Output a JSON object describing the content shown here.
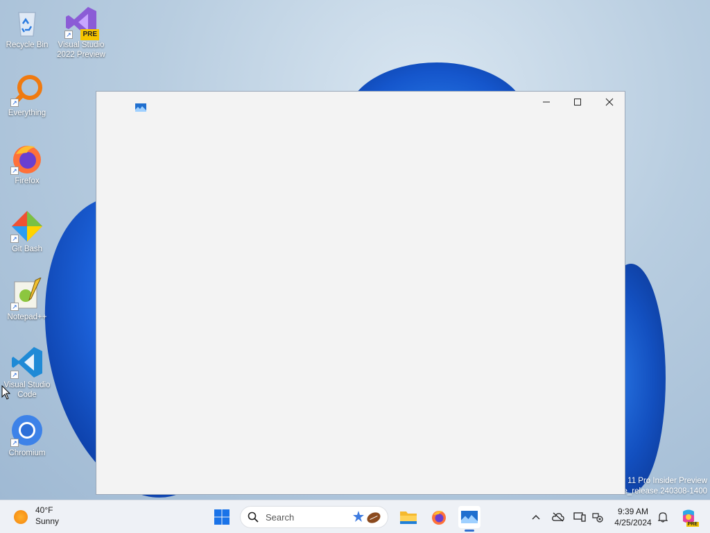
{
  "desktop": {
    "icons": [
      {
        "label": "Recycle Bin"
      },
      {
        "label": "Visual Studio 2022 Preview",
        "badge": "PRE"
      },
      {
        "label": "Everything"
      },
      {
        "label": "Firefox"
      },
      {
        "label": "Git Bash"
      },
      {
        "label": "Notepad++"
      },
      {
        "label": "Visual Studio Code"
      },
      {
        "label": "Chromium"
      }
    ],
    "watermark": {
      "line1": "11 Pro Insider Preview",
      "line2": "e_release.240308-1400"
    }
  },
  "window": {
    "icon": "app-image-icon",
    "controls": [
      "minimize-icon",
      "maximize-icon",
      "close-icon"
    ]
  },
  "taskbar": {
    "weather": {
      "temperature": "40°F",
      "condition": "Sunny"
    },
    "search_placeholder": "Search",
    "pinned": [
      "start-icon",
      "file-explorer-icon",
      "firefox-icon",
      "image-app-icon"
    ],
    "tray": [
      "chevron-up-icon",
      "onedrive-icon",
      "display-icon",
      "network-icon",
      "notification-bell-icon",
      "copilot-icon"
    ],
    "tray_badge": "PRE",
    "clock": {
      "time": "9:39 AM",
      "date": "4/25/2024"
    }
  },
  "colors": {
    "accent": "#2f6fd0",
    "window_bg": "#f3f3f3",
    "taskbar_bg": "#eef1f6"
  }
}
